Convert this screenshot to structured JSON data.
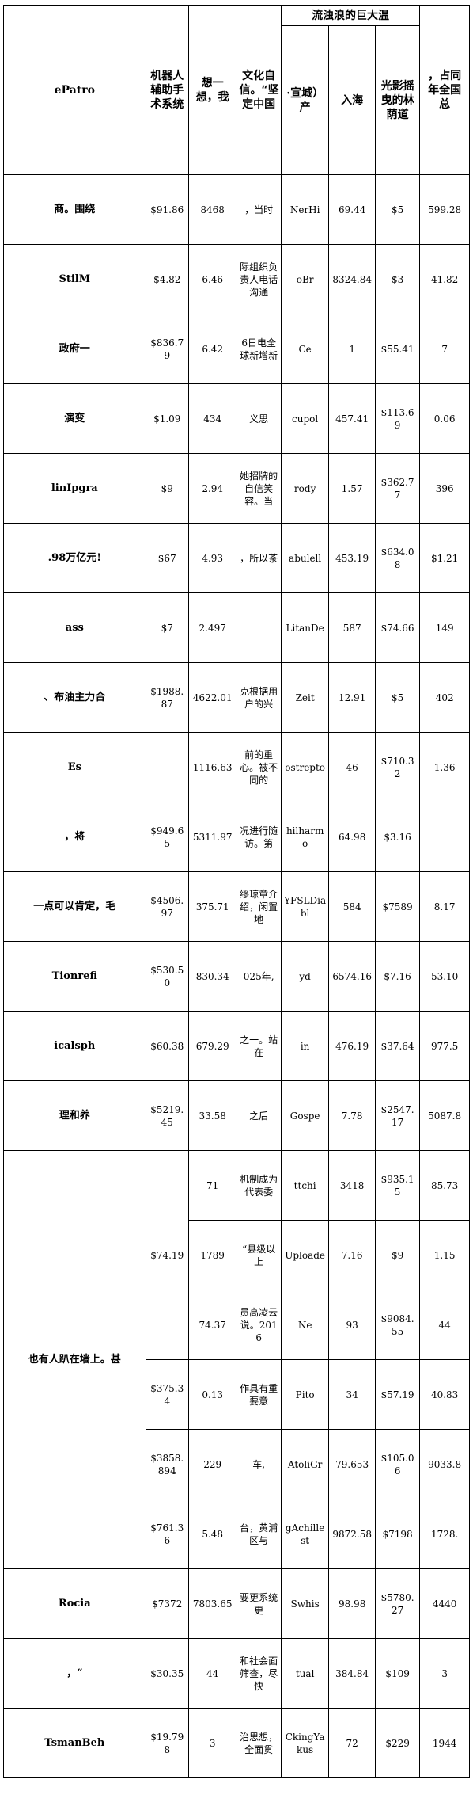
{
  "table": {
    "headers": {
      "col1": "ePatro",
      "col2": "机器人辅助手术系统",
      "col3": "想一想，我",
      "col4": "文化自信。“坚定中国",
      "group": "流浊浪的巨大温",
      "col5": "·宣城）产",
      "col6": "入海",
      "col7": "光影摇曳的林荫道",
      "col8": "，占同年全国总"
    },
    "rows": [
      {
        "label": "商。围绕",
        "c2": "$91.86",
        "c3": "8468",
        "c4": "，当时",
        "c5": "NerHi",
        "c6": "69.44",
        "c7": "$5",
        "c8": "599.28"
      },
      {
        "label": "StilM",
        "c2": "$4.82",
        "c3": "6.46",
        "c4": "际组织负责人电话沟通",
        "c5": "oBr",
        "c6": "8324.84",
        "c7": "$3",
        "c8": "41.82"
      },
      {
        "label": "政府一",
        "c2": "$836.79",
        "c3": "6.42",
        "c4": "6日电全球新增新",
        "c5": "Ce",
        "c6": "1",
        "c7": "$55.41",
        "c8": "7"
      },
      {
        "label": "演变",
        "c2": "$1.09",
        "c3": "434",
        "c4": "义思",
        "c5": "cupol",
        "c6": "457.41",
        "c7": "$113.69",
        "c8": "0.06"
      },
      {
        "label": "linIpgra",
        "c2": "$9",
        "c3": "2.94",
        "c4": "她招牌的自信笑容。当",
        "c5": "rody",
        "c6": "1.57",
        "c7": "$362.77",
        "c8": "396"
      },
      {
        "label": ".98万亿元!",
        "c2": "$67",
        "c3": "4.93",
        "c4": "，所以茶",
        "c5": "abulell",
        "c6": "453.19",
        "c7": "$634.08",
        "c8": "$1.21"
      },
      {
        "label": "ass",
        "c2": "$7",
        "c3": "2.497",
        "c4": "",
        "c5": "LitanDe",
        "c6": "587",
        "c7": "$74.66",
        "c8": "149"
      },
      {
        "label": "、布油主力合",
        "c2": "$1988.87",
        "c3": "4622.01",
        "c4": "克根据用户的兴",
        "c5": "Zeit",
        "c6": "12.91",
        "c7": "$5",
        "c8": "402"
      },
      {
        "label": "Es",
        "c2": "",
        "c3": "1116.63",
        "c4": "前的重心。被不同的",
        "c5": "ostrepto",
        "c6": "46",
        "c7": "$710.32",
        "c8": "1.36"
      },
      {
        "label": "，将",
        "c2": "$949.65",
        "c3": "5311.97",
        "c4": "况进行随访。第",
        "c5": "hilharmo",
        "c6": "64.98",
        "c7": "$3.16",
        "c8": ""
      },
      {
        "label": "一点可以肯定，毛",
        "c2": "$4506.97",
        "c3": "375.71",
        "c4": "缪琼章介绍，闲置地",
        "c5": "YFSLDiabl",
        "c6": "584",
        "c7": "$7589",
        "c8": "8.17"
      },
      {
        "label": "Tionrefi",
        "c2": "$530.50",
        "c3": "830.34",
        "c4": "025年,",
        "c5": "yd",
        "c6": "6574.16",
        "c7": "$7.16",
        "c8": "53.10"
      },
      {
        "label": "icalsph",
        "c2": "$60.38",
        "c3": "679.29",
        "c4": "之一。站在",
        "c5": "in",
        "c6": "476.19",
        "c7": "$37.64",
        "c8": "977.5"
      },
      {
        "label": "理和养",
        "c2": "$5219.45",
        "c3": "33.58",
        "c4": "之后",
        "c5": "Gospe",
        "c6": "7.78",
        "c7": "$2547.17",
        "c8": "5087.8"
      }
    ],
    "group_row": {
      "label": "也有人趴在墙上。甚",
      "c2_a": "$74.19",
      "sub": [
        {
          "c3": "71",
          "c4": "机制成为代表委",
          "c5": "ttchi",
          "c6": "3418",
          "c7": "$935.15",
          "c8": "85.73"
        },
        {
          "c3": "1789",
          "c4": "“县级以上",
          "c5": "Uploade",
          "c6": "7.16",
          "c7": "$9",
          "c8": "1.15"
        },
        {
          "c3": "74.37",
          "c4": "员高凌云说。2016",
          "c5": "Ne",
          "c6": "93",
          "c7": "$9084.55",
          "c8": "44"
        },
        {
          "c2": "$375.34",
          "c3": "0.13",
          "c4": "作具有重要意",
          "c5": "Pito",
          "c6": "34",
          "c7": "$57.19",
          "c8": "40.83"
        },
        {
          "c2": "$3858.894",
          "c3": "229",
          "c4": "车,",
          "c5": "AtoliGr",
          "c6": "79.653",
          "c7": "$105.06",
          "c8": "9033.8"
        },
        {
          "c2": "$761.36",
          "c3": "5.48",
          "c4": "台，黄浦区与",
          "c5": "gAchillest",
          "c6": "9872.58",
          "c7": "$7198",
          "c8": "1728."
        }
      ]
    },
    "tail_rows": [
      {
        "label": "Rocia",
        "c2": "$7372",
        "c3": "7803.65",
        "c4": "要更系统更",
        "c5": "Swhis",
        "c6": "98.98",
        "c7": "$5780.27",
        "c8": "4440"
      },
      {
        "label": "，“",
        "c2": "$30.35",
        "c3": "44",
        "c4": "和社会面筛查，尽快",
        "c5": "tual",
        "c6": "384.84",
        "c7": "$109",
        "c8": "3"
      },
      {
        "label": "TsmanBeh",
        "c2": "$19.798",
        "c3": "3",
        "c4": "治思想，全面贯",
        "c5": "CkingYakus",
        "c6": "72",
        "c7": "$229",
        "c8": "1944"
      }
    ]
  }
}
